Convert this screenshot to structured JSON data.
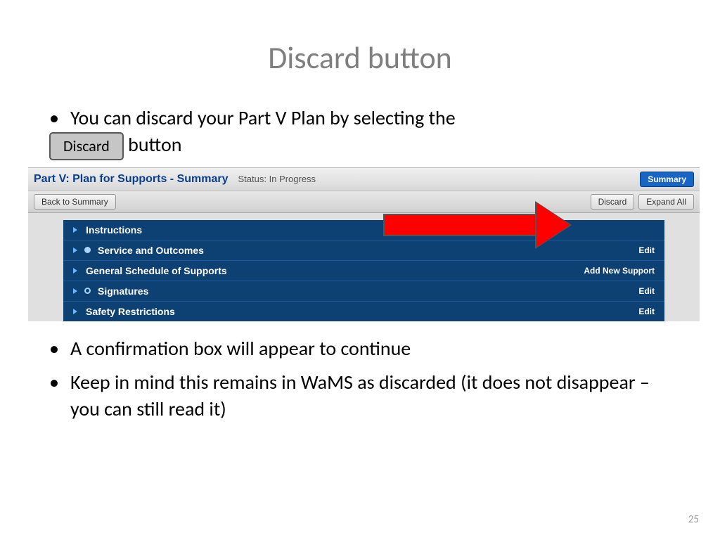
{
  "slide": {
    "title": "Discard button",
    "page_number": "25",
    "bullets": {
      "b1_pre": "You can discard your Part V Plan by selecting the",
      "b1_btn": "Discard",
      "b1_post": " button",
      "b2": "A confirmation box will appear to continue",
      "b3": "Keep in mind this remains in WaMS as discarded (it does not disappear – you can still read it)"
    }
  },
  "app": {
    "header_title": "Part V: Plan for Supports - Summary",
    "status": "Status: In Progress",
    "summary_btn": "Summary",
    "back_btn": "Back to Summary",
    "discard_btn": "Discard",
    "expand_btn": "Expand All",
    "rows": {
      "r0": {
        "label": "Instructions",
        "action": ""
      },
      "r1": {
        "label": "Service and Outcomes",
        "action": "Edit"
      },
      "r2": {
        "label": "General Schedule of Supports",
        "action": "Add New Support"
      },
      "r3": {
        "label": "Signatures",
        "action": "Edit"
      },
      "r4": {
        "label": "Safety Restrictions",
        "action": "Edit"
      }
    }
  }
}
